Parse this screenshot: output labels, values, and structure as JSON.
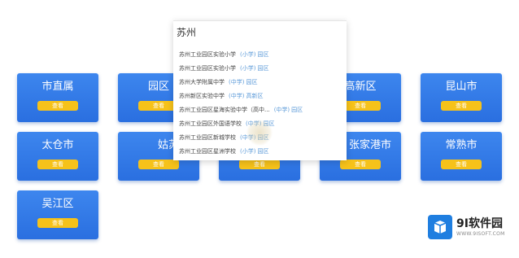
{
  "cards": [
    {
      "title": "市直属",
      "button": "查看"
    },
    {
      "title": "园区",
      "button": "查看"
    },
    {
      "title": "高新区",
      "button": "查看"
    },
    {
      "title": "昆山市",
      "button": "查看"
    },
    {
      "title": "太仓市",
      "button": "查看"
    },
    {
      "title": "姑苏区",
      "button": "查看"
    },
    {
      "title": "",
      "button": "查看"
    },
    {
      "title": "张家港市",
      "button": "查看"
    },
    {
      "title": "常熟市",
      "button": "查看"
    },
    {
      "title": "吴江区",
      "button": "查看"
    }
  ],
  "search": {
    "value": "苏州",
    "results": [
      {
        "school": "苏州工业园区实验小学",
        "district": "(小学)",
        "area": "园区"
      },
      {
        "school": "苏州工业园区实验小学",
        "district": "(小学)",
        "area": "园区"
      },
      {
        "school": "苏州大学附属中学",
        "district": "(中学)",
        "area": "园区"
      },
      {
        "school": "苏州新区实验中学",
        "district": "(中学)",
        "area": "高新区"
      },
      {
        "school": "苏州工业园区星海实验中学（高中...",
        "district": "(中学)",
        "area": "园区"
      },
      {
        "school": "苏州工业园区外国语学校",
        "district": "(中学)",
        "area": "园区"
      },
      {
        "school": "苏州工业园区新城学校",
        "district": "(中学)",
        "area": "园区"
      },
      {
        "school": "苏州工业园区星洲学校",
        "district": "(小学)",
        "area": "园区"
      }
    ]
  },
  "logo": {
    "name": "9I软件园",
    "url": "WWW.9ISOFT.COM",
    "color": "#1f7ee0"
  }
}
